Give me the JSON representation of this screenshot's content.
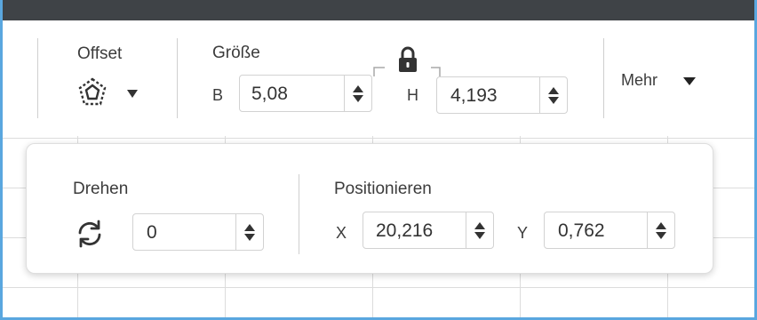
{
  "toolbar": {
    "offset": {
      "label": "Offset",
      "icon": "offset-polygon-icon"
    },
    "size": {
      "label": "Größe",
      "width_label": "B",
      "width_value": "5,08",
      "height_label": "H",
      "height_value": "4,193",
      "lock_icon": "lock-icon"
    },
    "more": {
      "label": "Mehr"
    }
  },
  "popover": {
    "rotate": {
      "label": "Drehen",
      "value": "0",
      "icon": "rotate-icon"
    },
    "position": {
      "label": "Positionieren",
      "x_label": "X",
      "x_value": "20,216",
      "y_label": "Y",
      "y_value": "0,762"
    }
  },
  "colors": {
    "topbar": "#3f4347",
    "frame_accent": "#5aa7df",
    "text": "#3a3a3a",
    "field_border": "#d2d2d2"
  }
}
